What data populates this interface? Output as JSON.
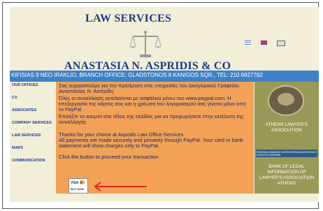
{
  "site": {
    "top_title": "LAW SERVICES",
    "main_title": "ANASTASIA N. ASPRIDIS & CO",
    "address": "KIFISIAS 9 NEO IRAKLIO, BRANCH OFFICE: GLADSTONOS 8 KANIGOS SQR., TEL: 210 6827782"
  },
  "nav": {
    "items": [
      "OUR OFFICES",
      "CV",
      "ASSOCIATES",
      "COMPANY SERVICES",
      "LAW SERVICES",
      "MAPS",
      "COMMUNICATION"
    ]
  },
  "content": {
    "greek_1": "Σας ευχαριστούμε για την προτίμηση στις υπηρεσίες του Δικηγορικού Γραφείου Αναστασίας Ν. Ασπρίδη",
    "greek_2": "Όλες οι συναλλαγές εκτελούνται με ασφάλεια μέσω του www.paypal.com. Η επεξεργασία της κάρτας σας και η χρέωση του λογαριασμού σας γίνεται μόνο από το PayPal",
    "greek_3": "Επιλέξτε το κουμπί στο τέλος της σελίδας για να προχωρήσετε στην εκτέλεση της συναλλαγής",
    "english_1": "Thanks for your choice at Aspridis Law Office Services",
    "english_2": "All payments are made securely and privately through PayPal. Your card or bank statement will show charges only to PayPal.",
    "english_3": "Click the button to proceed your transaction",
    "button_label": "BUY NOW",
    "button_cards": "VISA"
  },
  "right": {
    "assoc": "ATHENS LAWYER'S ASSOCIATION",
    "mid_banner": "ΤΡΑΠΕΖΑ ΝΟΜΙΚΩΝ ΠΛΗΡΟΦΟΡΙΩΝ ΔΙΚΗΓΟΡΙΚΟΥ ΣΥΛΛΟΓΟΥ ΑΘΗΝΩΝ",
    "bank": "BANK OF LEGAL INFORMATION OF LAWYER'S ASSOCIATION ATHENS"
  },
  "colors": {
    "brand_blue": "#1c3a88",
    "address_bar": "#3e82c6",
    "content_orange": "#f2a157",
    "right_olive": "#9a9a58",
    "arrow_red": "#e3261e"
  },
  "icons": [
    "scales-of-justice-icon",
    "greek-flag-icon",
    "uk-flag-icon",
    "email-icon",
    "arrow-left-icon"
  ]
}
